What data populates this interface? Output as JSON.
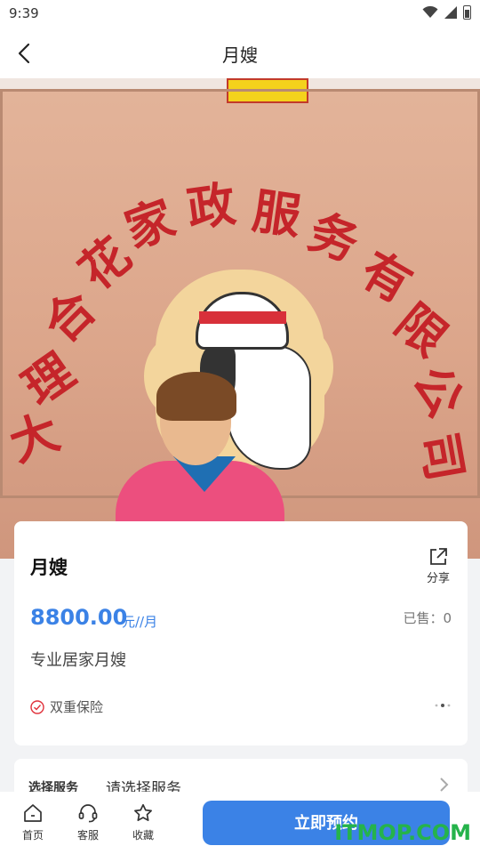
{
  "status_bar": {
    "time": "9:39"
  },
  "nav": {
    "title": "月嫂"
  },
  "hero": {
    "sign_chars": [
      "大",
      "理",
      "合",
      "花",
      "家",
      "政",
      "服",
      "务",
      "有",
      "限",
      "公",
      "司"
    ],
    "colors": {
      "wall": "#dca68b",
      "text": "#c5252a"
    }
  },
  "product": {
    "title": "月嫂",
    "share_label": "分享",
    "price": "8800.00",
    "price_unit": "元//月",
    "sold": "已售：0",
    "description": "专业居家月嫂",
    "badge": "双重保险"
  },
  "select_service": {
    "label": "选择服务",
    "value": "请选择服务"
  },
  "bottom_bar": {
    "tabs": [
      {
        "label": "首页",
        "icon": "home-icon"
      },
      {
        "label": "客服",
        "icon": "headset-icon"
      },
      {
        "label": "收藏",
        "icon": "star-icon"
      }
    ],
    "book_label": "立即预约"
  },
  "watermark": "ITMOP.COM",
  "colors": {
    "accent": "#3b82e6",
    "badge_red": "#e0303a"
  }
}
